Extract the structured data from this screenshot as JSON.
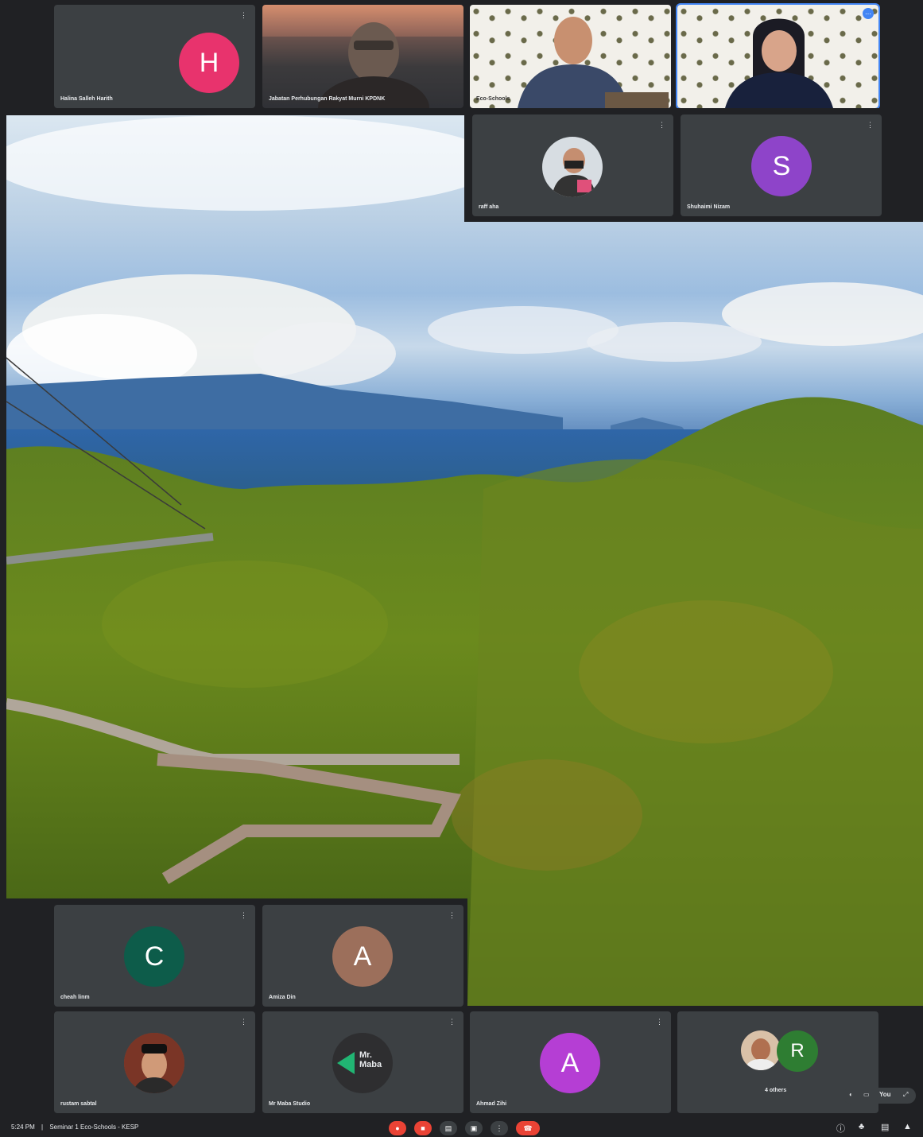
{
  "meeting": {
    "time": "5:24 PM",
    "separator": "|",
    "title": "Seminar 1 Eco-Schools - KESP"
  },
  "participants": {
    "halina": {
      "initial": "H",
      "name": "Halina Salleh Harith",
      "color": "#e8336d"
    },
    "jabatan": {
      "name": "Jabatan Perhubungan Rakyat Murni KPDNK"
    },
    "man_speaker": {
      "name": "Eco-Schools"
    },
    "woman_speaker": {},
    "rafi": {
      "name": "raff aha"
    },
    "shuhaimi": {
      "initial": "S",
      "name": "Shuhaimi Nizam",
      "color": "#8e44c9"
    },
    "cheah": {
      "initial": "C",
      "name": "cheah linm",
      "color": "#0d5c4a"
    },
    "amiza": {
      "initial": "A",
      "name": "Amiza Din",
      "color": "#9c6f5b"
    },
    "rustam": {
      "name": "rustam sabtal"
    },
    "mrmaba": {
      "name": "Mr Maba Studio",
      "logo_line1": "Mr.",
      "logo_line2": "Maba"
    },
    "ahmad": {
      "initial": "A",
      "name": "Ahmad Zihi",
      "color": "#b53ed4"
    },
    "others": {
      "initial": "R",
      "label": "4 others",
      "color": "#2e7d32"
    }
  },
  "view_pill": {
    "label": "You"
  },
  "icons": {
    "mic": "mic-off-icon",
    "camera": "camera-icon",
    "captions": "captions-icon",
    "present": "present-icon",
    "more": "more-icon",
    "hangup": "hang-up-icon",
    "info": "info-icon",
    "people": "people-icon",
    "chat": "chat-icon",
    "activities": "activities-icon"
  }
}
